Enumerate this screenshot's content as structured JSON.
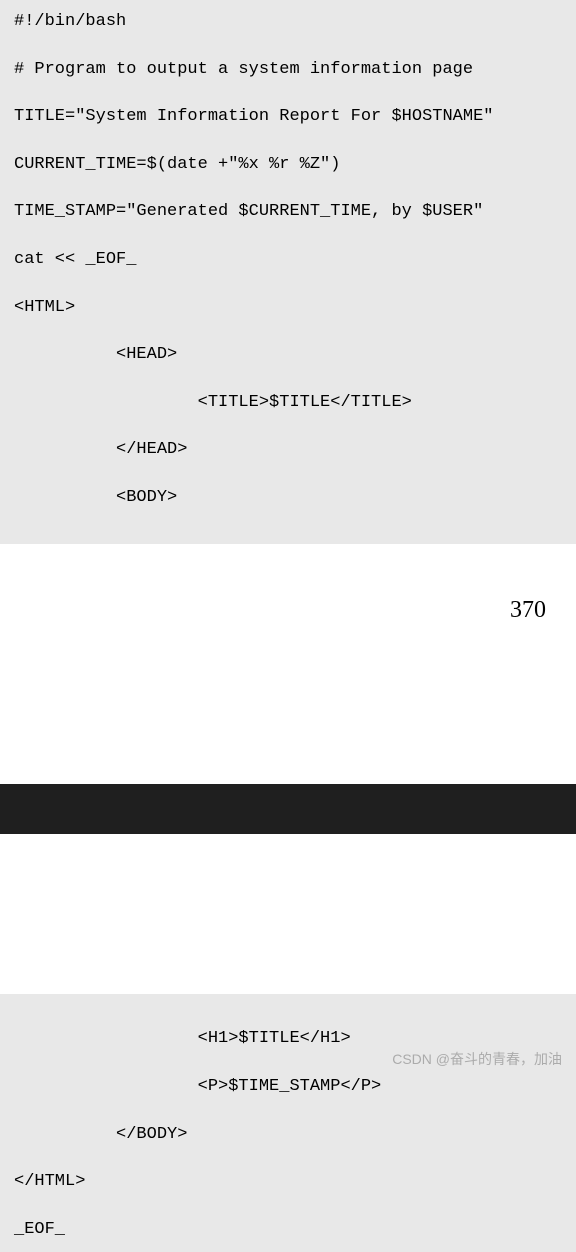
{
  "code_top": {
    "lines": [
      "#!/bin/bash",
      "",
      "# Program to output a system information page",
      "",
      "TITLE=\"System Information Report For $HOSTNAME\"",
      "",
      "CURRENT_TIME=$(date +\"%x %r %Z\")",
      "",
      "TIME_STAMP=\"Generated $CURRENT_TIME, by $USER\"",
      "",
      "cat << _EOF_",
      "",
      "<HTML>",
      "",
      "          <HEAD>",
      "",
      "                  <TITLE>$TITLE</TITLE>",
      "",
      "          </HEAD>",
      "",
      "          <BODY>",
      ""
    ]
  },
  "page_number": "370",
  "code_bottom": {
    "lines": [
      "",
      "                  <H1>$TITLE</H1>",
      "",
      "                  <P>$TIME_STAMP</P>",
      "",
      "          </BODY>",
      "",
      "</HTML>",
      "",
      "_EOF_"
    ]
  },
  "watermark": "CSDN @奋斗的青春，加油"
}
